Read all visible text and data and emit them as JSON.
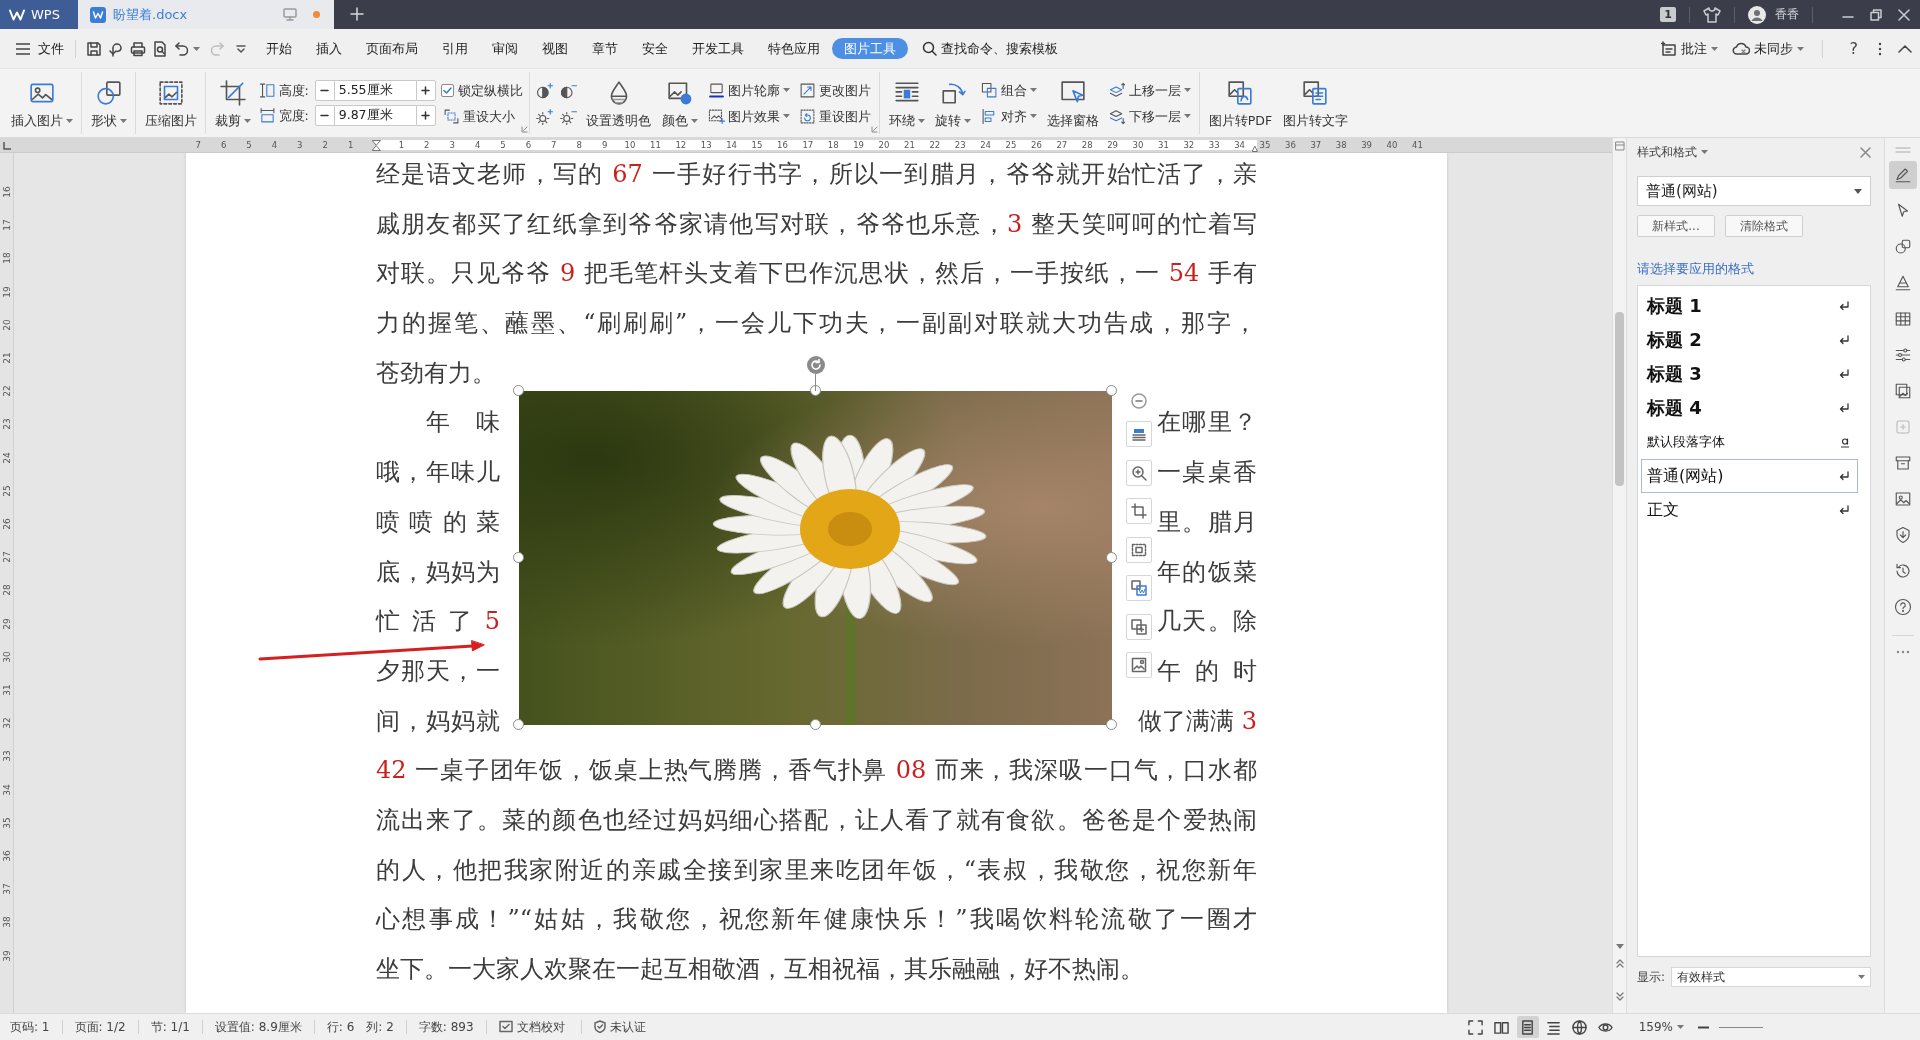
{
  "title_bar": {
    "app_tab": "WPS",
    "document_tab": {
      "title": "盼望着.docx",
      "modified": true
    },
    "badge": "1",
    "user": "香香"
  },
  "menu_bar": {
    "file": "文件",
    "redo_disabled": true,
    "tabs": [
      {
        "label": "开始",
        "selected": false
      },
      {
        "label": "插入",
        "selected": false
      },
      {
        "label": "页面布局",
        "selected": false
      },
      {
        "label": "引用",
        "selected": false
      },
      {
        "label": "审阅",
        "selected": false
      },
      {
        "label": "视图",
        "selected": false
      },
      {
        "label": "章节",
        "selected": false
      },
      {
        "label": "安全",
        "selected": false
      },
      {
        "label": "开发工具",
        "selected": false
      },
      {
        "label": "特色应用",
        "selected": false
      },
      {
        "label": "图片工具",
        "selected": true
      }
    ],
    "search_placeholder": "查找命令、搜索模板",
    "comment": "批注",
    "sync": "未同步",
    "help": "?"
  },
  "ribbon": {
    "groups": [
      {
        "columns": [
          [
            {
              "kind": "large",
              "label": "插入图片",
              "caret": true
            }
          ]
        ]
      },
      {
        "columns": [
          [
            {
              "kind": "large",
              "label": "形状",
              "caret": true
            }
          ]
        ]
      },
      {
        "columns": [
          [
            {
              "kind": "large",
              "label": "压缩图片",
              "caret": false
            }
          ]
        ]
      },
      {
        "launcher": true,
        "columns": [
          [
            {
              "kind": "large",
              "label": "裁剪",
              "caret": true
            }
          ],
          [
            {
              "kind": "spin",
              "label": "高度:",
              "value": "5.55厘米"
            },
            {
              "kind": "spin",
              "label": "宽度:",
              "value": "9.87厘米"
            }
          ],
          [
            {
              "kind": "checkbox",
              "label": "锁定纵横比",
              "checked": true
            },
            {
              "kind": "small",
              "label": "重设大小",
              "caret": false
            }
          ]
        ]
      },
      {
        "launcher": true,
        "columns": [
          [
            {
              "kind": "adjustments"
            }
          ],
          [
            {
              "kind": "large",
              "label": "设置透明色",
              "caret": false
            }
          ],
          [
            {
              "kind": "large",
              "label": "颜色",
              "caret": true
            }
          ],
          [
            {
              "kind": "small",
              "label": "图片轮廓",
              "caret": true
            },
            {
              "kind": "small",
              "label": "图片效果",
              "caret": true
            }
          ],
          [
            {
              "kind": "small",
              "label": "更改图片",
              "caret": false
            },
            {
              "kind": "small",
              "label": "重设图片",
              "caret": false
            }
          ]
        ]
      },
      {
        "columns": [
          [
            {
              "kind": "large",
              "label": "环绕",
              "caret": true
            }
          ],
          [
            {
              "kind": "large",
              "label": "旋转",
              "caret": true
            }
          ],
          [
            {
              "kind": "small",
              "label": "组合",
              "caret": true
            },
            {
              "kind": "small",
              "label": "对齐",
              "caret": true
            }
          ],
          [
            {
              "kind": "large",
              "label": "选择窗格",
              "caret": false
            }
          ],
          [
            {
              "kind": "small",
              "label": "上移一层",
              "caret": true
            },
            {
              "kind": "small",
              "label": "下移一层",
              "caret": true
            }
          ]
        ]
      },
      {
        "columns": [
          [
            {
              "kind": "large",
              "label": "图片转PDF",
              "caret": false
            }
          ],
          [
            {
              "kind": "large",
              "label": "图片转文字",
              "caret": false
            }
          ]
        ]
      }
    ]
  },
  "ruler": {
    "horizontal": [
      "7",
      "6",
      "5",
      "4",
      "3",
      "2",
      "1",
      "1",
      "2",
      "3",
      "4",
      "5",
      "6",
      "7",
      "8",
      "9",
      "10",
      "11",
      "12",
      "13",
      "14",
      "15",
      "16",
      "17",
      "18",
      "19",
      "20",
      "21",
      "22",
      "23",
      "24",
      "25",
      "26",
      "27",
      "28",
      "29",
      "30",
      "31",
      "32",
      "33",
      "34",
      "35",
      "36",
      "37",
      "38",
      "39",
      "40",
      "41"
    ],
    "vertical": [
      "16",
      "17",
      "18",
      "19",
      "20",
      "21",
      "22",
      "23",
      "24",
      "25",
      "26",
      "27",
      "28",
      "29",
      "30",
      "31",
      "32",
      "33",
      "34",
      "35",
      "36",
      "37",
      "38",
      "39"
    ]
  },
  "document": {
    "top_lines": [
      {
        "runs": [
          {
            "text": "经是语文老师，写的 "
          },
          {
            "text": "67",
            "color": "#c9211e"
          },
          {
            "text": " 一手好行书字，所以一到腊月，爷爷就开始忙活了，亲"
          }
        ],
        "paragraph_end": false
      },
      {
        "runs": [
          {
            "text": "戚朋友都买了红纸拿到爷爷家请他写对联，爷爷也乐意，"
          },
          {
            "text": "3",
            "color": "#c9211e"
          },
          {
            "text": " 整天笑呵呵的忙着写"
          }
        ],
        "paragraph_end": false
      },
      {
        "runs": [
          {
            "text": "对联。只见爷爷 "
          },
          {
            "text": "9",
            "color": "#c9211e"
          },
          {
            "text": " 把毛笔杆头支着下巴作沉思状，然后，一手按纸，一 "
          },
          {
            "text": "54",
            "color": "#c9211e"
          },
          {
            "text": " 手有"
          }
        ],
        "paragraph_end": false
      },
      {
        "runs": [
          {
            "text": "力的握笔、蘸墨、“刷刷刷”，一会儿下功夫，一副副对联就大功告成，那字，"
          }
        ],
        "paragraph_end": false
      },
      {
        "runs": [
          {
            "text": "苍劲有力。"
          }
        ],
        "paragraph_end": true
      }
    ],
    "picture": {
      "selected": true
    },
    "wrap_left": [
      {
        "runs": [
          {
            "text": "年 味"
          }
        ],
        "indent": true
      },
      {
        "runs": [
          {
            "text": "哦，年味儿"
          }
        ],
        "indent": false
      },
      {
        "runs": [
          {
            "text": "喷 喷 的 菜"
          }
        ],
        "indent": false
      },
      {
        "runs": [
          {
            "text": "底，妈妈为"
          }
        ],
        "indent": false
      },
      {
        "runs": [
          {
            "text": "忙 活 了 "
          },
          {
            "text": "5",
            "color": "#c9211e"
          }
        ],
        "indent": false
      },
      {
        "runs": [
          {
            "text": "夕那天，一"
          }
        ],
        "indent": false
      },
      {
        "runs": [
          {
            "text": "间，妈妈就"
          }
        ],
        "indent": false
      }
    ],
    "wrap_right": [
      {
        "runs": [
          {
            "text": "在哪里？"
          }
        ]
      },
      {
        "runs": [
          {
            "text": "一桌桌香"
          }
        ]
      },
      {
        "runs": [
          {
            "text": "里。腊月"
          }
        ]
      },
      {
        "runs": [
          {
            "text": "年的饭菜"
          }
        ]
      },
      {
        "runs": [
          {
            "text": "几天。除"
          }
        ]
      },
      {
        "runs": [
          {
            "text": "午 的 时"
          }
        ]
      },
      {
        "runs": [
          {
            "text": "做了满满 "
          },
          {
            "text": "3",
            "color": "#c9211e"
          }
        ]
      }
    ],
    "bottom_lines": [
      {
        "runs": [
          {
            "text": "42",
            "color": "#c9211e"
          },
          {
            "text": " 一桌子团年饭，饭桌上热气腾腾，香气扑鼻 "
          },
          {
            "text": "08",
            "color": "#c9211e"
          },
          {
            "text": " 而来，我深吸一口气，口水都"
          }
        ],
        "paragraph_end": false
      },
      {
        "runs": [
          {
            "text": "流出来了。菜的颜色也经过妈妈细心搭配，让人看了就有食欲。爸爸是个爱热闹"
          }
        ],
        "paragraph_end": false
      },
      {
        "runs": [
          {
            "text": "的人，他把我家附近的亲戚全接到家里来吃团年饭，“表叔，我敬您，祝您新年"
          }
        ],
        "paragraph_end": false
      },
      {
        "runs": [
          {
            "text": "心想事成！”“姑姑，我敬您，祝您新年健康快乐！”我喝饮料轮流敬了一圈才"
          }
        ],
        "paragraph_end": false
      },
      {
        "runs": [
          {
            "text": "坐下。一大家人欢聚在一起互相敬酒，互相祝福，其乐融融，好不热闹。"
          }
        ],
        "paragraph_end": true
      }
    ]
  },
  "styles_panel": {
    "title": "样式和格式",
    "current_style": "普通(网站)",
    "buttons": [
      "新样式...",
      "清除格式"
    ],
    "prompt": "请选择要应用的格式",
    "styles": [
      {
        "label": "标题 1",
        "kind": "heading",
        "selected": false
      },
      {
        "label": "标题 2",
        "kind": "heading",
        "selected": false
      },
      {
        "label": "标题 3",
        "kind": "heading",
        "selected": false
      },
      {
        "label": "标题 4",
        "kind": "heading",
        "selected": false
      },
      {
        "label": "默认段落字体",
        "kind": "character",
        "selected": false
      },
      {
        "label": "普通(网站)",
        "kind": "paragraph",
        "selected": true
      },
      {
        "label": "正文",
        "kind": "paragraph",
        "selected": false
      }
    ],
    "show_label": "显示:",
    "show_value": "有效样式"
  },
  "side_tools": [
    {
      "selected": true,
      "disabled": false
    },
    {
      "selected": false,
      "disabled": false
    },
    {
      "selected": false,
      "disabled": false
    },
    {
      "selected": false,
      "disabled": false
    },
    {
      "selected": false,
      "disabled": false
    },
    {
      "selected": false,
      "disabled": false
    },
    {
      "selected": false,
      "disabled": false
    },
    {
      "selected": false,
      "disabled": true
    },
    {
      "selected": false,
      "disabled": false
    },
    {
      "selected": false,
      "disabled": false
    },
    {
      "selected": false,
      "disabled": false
    },
    {
      "selected": false,
      "disabled": false
    },
    {
      "selected": false,
      "disabled": false
    }
  ],
  "status_bar": {
    "fields": [
      "页码: 1",
      "页面: 1/2",
      "节: 1/1",
      "设置值: 8.9厘米",
      "行: 6",
      "列: 2",
      "字数: 893"
    ],
    "proofread": "文档校对",
    "certification": "未认证",
    "views": [
      {
        "selected": false
      },
      {
        "selected": false
      },
      {
        "selected": true
      },
      {
        "selected": false
      },
      {
        "selected": false
      },
      {
        "selected": false
      }
    ],
    "zoom": "159%"
  }
}
